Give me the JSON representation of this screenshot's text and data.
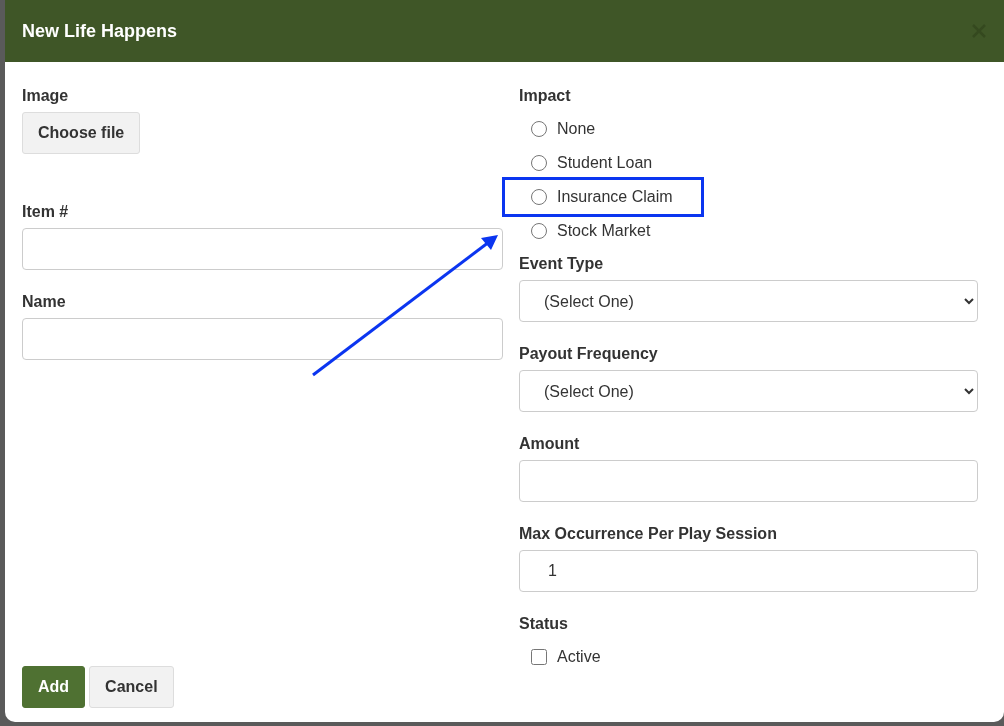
{
  "dialog": {
    "title": "New Life Happens"
  },
  "left_fields": [
    {
      "kind": "file",
      "label": "Image",
      "button": "Choose file"
    },
    {
      "kind": "text",
      "label": "Item #"
    },
    {
      "kind": "text",
      "label": "Name"
    }
  ],
  "right_fields": [
    {
      "kind": "radios",
      "label": "Impact",
      "options": [
        {
          "label": "None",
          "selected": false,
          "highlighted": false
        },
        {
          "label": "Student Loan",
          "selected": false,
          "highlighted": false
        },
        {
          "label": "Insurance Claim",
          "selected": false,
          "highlighted": true
        },
        {
          "label": "Stock Market",
          "selected": false,
          "highlighted": false
        }
      ]
    },
    {
      "kind": "select",
      "label": "Event Type",
      "value": "(Select One)"
    },
    {
      "kind": "select",
      "label": "Payout Frequency",
      "value": "(Select One)"
    },
    {
      "kind": "text",
      "label": "Amount"
    },
    {
      "kind": "text",
      "label": "Max Occurrence Per Play Session",
      "value": "1"
    },
    {
      "kind": "checkboxes",
      "label": "Status",
      "options": [
        {
          "label": "Active",
          "checked": false
        }
      ]
    }
  ],
  "buttons": [
    {
      "label": "Add",
      "kind": "primary"
    },
    {
      "label": "Cancel",
      "kind": "secondary"
    }
  ]
}
